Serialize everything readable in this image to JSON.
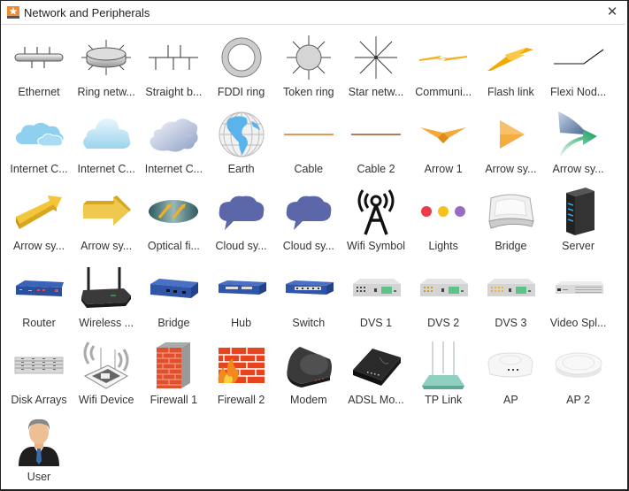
{
  "window": {
    "title": "Network and Peripherals",
    "close_icon": "close-icon"
  },
  "shapes": [
    {
      "label": "Ethernet",
      "icon": "ethernet-icon"
    },
    {
      "label": "Ring netw...",
      "icon": "ring-network-icon"
    },
    {
      "label": "Straight b...",
      "icon": "straight-bus-icon"
    },
    {
      "label": "FDDI ring",
      "icon": "fddi-ring-icon"
    },
    {
      "label": "Token ring",
      "icon": "token-ring-icon"
    },
    {
      "label": "Star netw...",
      "icon": "star-network-icon"
    },
    {
      "label": "Communi...",
      "icon": "communication-link-icon"
    },
    {
      "label": "Flash link",
      "icon": "flash-link-icon"
    },
    {
      "label": "Flexi Nod...",
      "icon": "flexi-node-icon"
    },
    {
      "label": "Internet C...",
      "icon": "internet-cloud-1-icon"
    },
    {
      "label": "Internet C...",
      "icon": "internet-cloud-2-icon"
    },
    {
      "label": "Internet C...",
      "icon": "internet-cloud-3-icon"
    },
    {
      "label": "Earth",
      "icon": "earth-icon"
    },
    {
      "label": "Cable",
      "icon": "cable-icon"
    },
    {
      "label": "Cable 2",
      "icon": "cable-2-icon"
    },
    {
      "label": "Arrow 1",
      "icon": "arrow-1-icon"
    },
    {
      "label": "Arrow sy...",
      "icon": "arrow-symbol-play-icon"
    },
    {
      "label": "Arrow sy...",
      "icon": "arrow-symbol-merge-icon"
    },
    {
      "label": "Arrow sy...",
      "icon": "arrow-symbol-diagonal-icon"
    },
    {
      "label": "Arrow sy...",
      "icon": "arrow-symbol-right-icon"
    },
    {
      "label": "Optical fi...",
      "icon": "optical-fiber-icon"
    },
    {
      "label": "Cloud sy...",
      "icon": "cloud-symbol-1-icon"
    },
    {
      "label": "Cloud sy...",
      "icon": "cloud-symbol-2-icon"
    },
    {
      "label": "Wifi Symbol",
      "icon": "wifi-tower-icon"
    },
    {
      "label": "Lights",
      "icon": "lights-icon"
    },
    {
      "label": "Bridge",
      "icon": "bridge-device-icon"
    },
    {
      "label": "Server",
      "icon": "server-icon"
    },
    {
      "label": "Router",
      "icon": "router-icon"
    },
    {
      "label": "Wireless ...",
      "icon": "wireless-router-icon"
    },
    {
      "label": "Bridge",
      "icon": "bridge-icon"
    },
    {
      "label": "Hub",
      "icon": "hub-icon"
    },
    {
      "label": "Switch",
      "icon": "switch-icon"
    },
    {
      "label": "DVS 1",
      "icon": "dvs-1-icon"
    },
    {
      "label": "DVS 2",
      "icon": "dvs-2-icon"
    },
    {
      "label": "DVS 3",
      "icon": "dvs-3-icon"
    },
    {
      "label": "Video Spl...",
      "icon": "video-splitter-icon"
    },
    {
      "label": "Disk Arrays",
      "icon": "disk-arrays-icon"
    },
    {
      "label": "Wifi Device",
      "icon": "wifi-device-icon"
    },
    {
      "label": "Firewall 1",
      "icon": "firewall-1-icon"
    },
    {
      "label": "Firewall 2",
      "icon": "firewall-2-icon"
    },
    {
      "label": "Modem",
      "icon": "modem-icon"
    },
    {
      "label": "ADSL Mo...",
      "icon": "adsl-modem-icon"
    },
    {
      "label": "TP Link",
      "icon": "tp-link-icon"
    },
    {
      "label": "AP",
      "icon": "access-point-icon"
    },
    {
      "label": "AP 2",
      "icon": "access-point-2-icon"
    },
    {
      "label": "User",
      "icon": "user-icon"
    }
  ]
}
